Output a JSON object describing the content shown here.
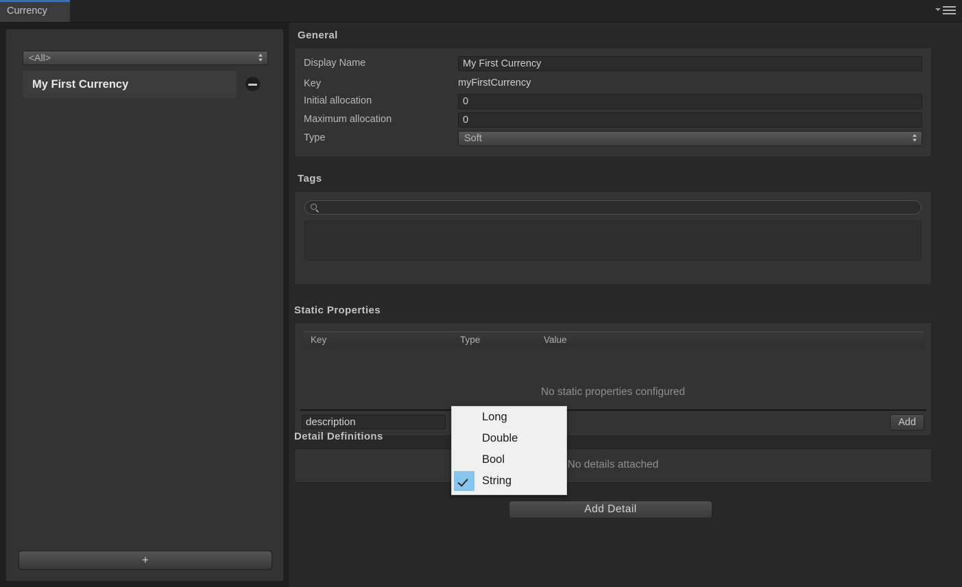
{
  "window": {
    "tab_label": "Currency",
    "menu_icon": "hamburger-menu-icon",
    "accent_color": "#3c6eb4"
  },
  "sidebar": {
    "filter": {
      "selected": "<All>",
      "icon": "updown-arrows-icon"
    },
    "items": [
      {
        "label": "My First Currency",
        "remove_icon": "minus-circle-icon"
      }
    ],
    "add_button_label": "+"
  },
  "general": {
    "title": "General",
    "fields": [
      {
        "label": "Display Name",
        "value": "My First Currency",
        "kind": "input"
      },
      {
        "label": "Key",
        "value": "myFirstCurrency",
        "kind": "static"
      },
      {
        "label": "Initial allocation",
        "value": "0",
        "kind": "input"
      },
      {
        "label": "Maximum allocation",
        "value": "0",
        "kind": "input"
      },
      {
        "label": "Type",
        "value": "Soft",
        "kind": "select"
      }
    ]
  },
  "tags": {
    "title": "Tags",
    "search": {
      "value": "",
      "placeholder": "",
      "icon": "search-icon"
    }
  },
  "static_properties": {
    "title": "Static Properties",
    "columns": [
      "Key",
      "Type",
      "Value"
    ],
    "rows": [],
    "empty_text": "No static properties configured",
    "new_row": {
      "key_value": "description",
      "type_value": "String",
      "add_label": "Add"
    }
  },
  "type_menu": {
    "open": true,
    "options": [
      "Long",
      "Double",
      "Bool",
      "String"
    ],
    "selected": "String",
    "highlight_color": "#86c5ed"
  },
  "detail_definitions": {
    "title": "Detail Definitions",
    "empty_text": "No details attached",
    "add_button_label": "Add Detail"
  }
}
